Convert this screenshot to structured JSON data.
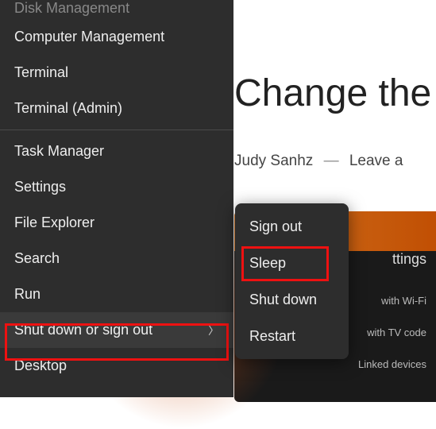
{
  "background": {
    "title": "Change the",
    "author": "Judy Sanhz",
    "separator": "—",
    "comments_label": "Leave a",
    "panel": {
      "header": "ttings",
      "items": [
        "with Wi-Fi",
        "with TV code",
        "Linked devices"
      ]
    }
  },
  "menu": {
    "items": [
      {
        "label": "Disk Management",
        "cut": true
      },
      {
        "label": "Computer Management"
      },
      {
        "label": "Terminal"
      },
      {
        "label": "Terminal (Admin)"
      }
    ],
    "items2": [
      {
        "label": "Task Manager"
      },
      {
        "label": "Settings"
      },
      {
        "label": "File Explorer"
      },
      {
        "label": "Search"
      },
      {
        "label": "Run"
      },
      {
        "label": "Shut down or sign out",
        "hasSubmenu": true,
        "hovered": true
      },
      {
        "label": "Desktop"
      }
    ]
  },
  "submenu": {
    "items": [
      {
        "label": "Sign out"
      },
      {
        "label": "Sleep"
      },
      {
        "label": "Shut down"
      },
      {
        "label": "Restart"
      }
    ]
  }
}
